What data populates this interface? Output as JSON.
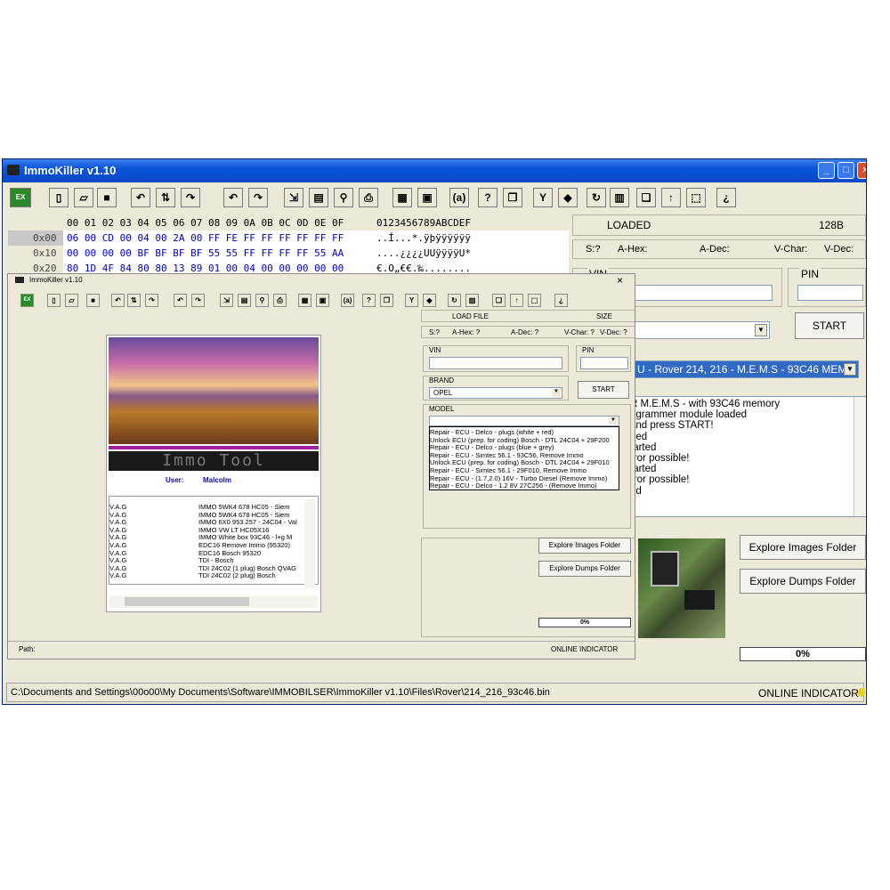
{
  "window": {
    "title": "ImmoKiller v1.10",
    "caption_min": "_",
    "caption_max": "□",
    "caption_close": "×"
  },
  "toolbar": {
    "icons": [
      "exe-icon",
      "new-file-icon",
      "open-folder-icon",
      "save-icon",
      "import-icon",
      "swap-icon",
      "export-icon",
      "undo-icon",
      "redo-icon",
      "goto-icon",
      "document-icon",
      "find-icon",
      "print-icon",
      "calculator-icon",
      "checksum-icon",
      "ascii-icon",
      "help-icon",
      "book-icon",
      "key-icon",
      "chip-icon",
      "refresh-icon",
      "columns-icon",
      "copy-icon",
      "up-icon",
      "select-icon",
      "bulb-icon"
    ],
    "glyphs": [
      "EX",
      "▯",
      "▱",
      "■",
      "↶",
      "⇅",
      "↷",
      "↶",
      "↷",
      "⇲",
      "▤",
      "⚲",
      "⎙",
      "▦",
      "▣",
      "(a)",
      "?",
      "❐",
      "Y",
      "◆",
      "↻",
      "▥",
      "❏",
      "↑",
      "⬚",
      "¿"
    ]
  },
  "hex": {
    "header": "00 01 02 03 04 05 06 07 08 09 0A 0B 0C 0D 0E 0F",
    "ascii_header": "0123456789ABCDEF",
    "rows": [
      {
        "addr": "0x00",
        "bytes": "06 00 CD 00 04 00 2A 00 FF FE FF FF FF FF FF FF",
        "ascii": "..Í...*.ÿþÿÿÿÿÿÿ"
      },
      {
        "addr": "0x10",
        "bytes": "00 00 00 00 BF BF BF BF 55 55 FF FF FF FF 55 AA",
        "ascii": "....¿¿¿¿UUÿÿÿÿU*"
      },
      {
        "addr": "0x20",
        "bytes": "80 1D 4F 84 80 80 13 89 01 00 04 00 00 00 00 00",
        "ascii": "€.O„€€.‰........"
      }
    ]
  },
  "right_panel": {
    "loaded_label": "LOADED",
    "size_value": "128B",
    "s_label": "S:?",
    "ahex_label": "A-Hex:",
    "adec_label": "A-Dec:",
    "vchar_label": "V-Char:",
    "vdec_label": "V-Dec:",
    "vin_label": "VIN",
    "pin_label": "PIN",
    "start_button": "START",
    "model_selected": "U - Rover 214, 216 - M.E.M.S - 93C46 MEM",
    "log_lines": [
      "R M.E.M.S - with 93C46 memory",
      "ogrammer module loaded",
      "and press START!",
      "ded",
      "tarted",
      "rror possible!",
      "tarted",
      "rror possible!",
      "ed"
    ],
    "explore_images": "Explore Images Folder",
    "explore_dumps": "Explore Dumps Folder",
    "progress": "0%",
    "online_indicator": "ONLINE INDICATOR"
  },
  "status": {
    "path": "C:\\Documents and Settings\\00o00\\My Documents\\Software\\IMMOBILSER\\ImmoKiller v1.10\\Files\\Rover\\214_216_93c46.bin"
  },
  "inner": {
    "title": "ImmoKiller v1.10",
    "close": "×",
    "splash_text": "Immo Tool",
    "user_label": "User:",
    "user_name": "Malcolm",
    "list_left": [
      "V.A.G",
      "V.A.G",
      "V.A.G",
      "V.A.G",
      "V.A.G",
      "V.A.G",
      "V.A.G",
      "V.A.G",
      "V.A.G",
      "V.A.G"
    ],
    "list_right": [
      "IMMO 5WK4 678    HC05 - Siem",
      "IMMO 5WK4 678    HC05 - Siem",
      "IMMO 6X0 953 257 - 24C04 - Val",
      "IMMO VW LT       HC05X16",
      "IMMO White box   93C46 - l+g M",
      "EDC16  Remove Immo (95320)",
      "EDC16 Bosch 95320",
      "TDI - Bosch",
      "TDI 24C02 (1 plug) Bosch QVAG",
      "TDI 24C02 (2 plug) Bosch"
    ],
    "load_file": "LOAD FILE",
    "size": "SIZE",
    "s_label": "S:?",
    "ahex": "A-Hex: ?",
    "adec": "A-Dec: ?",
    "vchar": "V-Char: ?",
    "vdec": "V-Dec: ?",
    "vin_label": "VIN",
    "pin_label": "PIN",
    "brand_label": "BRAND",
    "brand_value": "OPEL",
    "start": "START",
    "model_label": "MODEL",
    "model_items": [
      "Repair - ECU - Delco - plugs (white + red)",
      "Unlock ECU (prep. for coding) Bosch - DTL 24C04 + 29F200",
      "Repair - ECU - Delco - plugs (blue + grey)",
      "Repair - ECU - Simtec 56.1 - 93C56, Remove Immo",
      "Unlock ECU (prep. for coding) Bosch - DTL 24C04 + 29F010",
      "Repair - ECU - Simtec 56.1 - 29F010, Remove Immo",
      "Repair - ECU - (1.7,2.0) 16V - Turbo Diesel (Remove Immo)",
      "Repair - ECU - Delco - 1.2 8V 27C256 - (Remove Immo)"
    ],
    "explore_images": "Explore Images Folder",
    "explore_dumps": "Explore Dumps Folder",
    "progress": "0%",
    "path_label": "Path:",
    "online_indicator": "ONLINE INDICATOR"
  },
  "colors": {
    "titlebar": "#0a54d8",
    "selection": "#316ac5",
    "hex_blue": "#0000c0",
    "window_bg": "#ece9d8"
  }
}
